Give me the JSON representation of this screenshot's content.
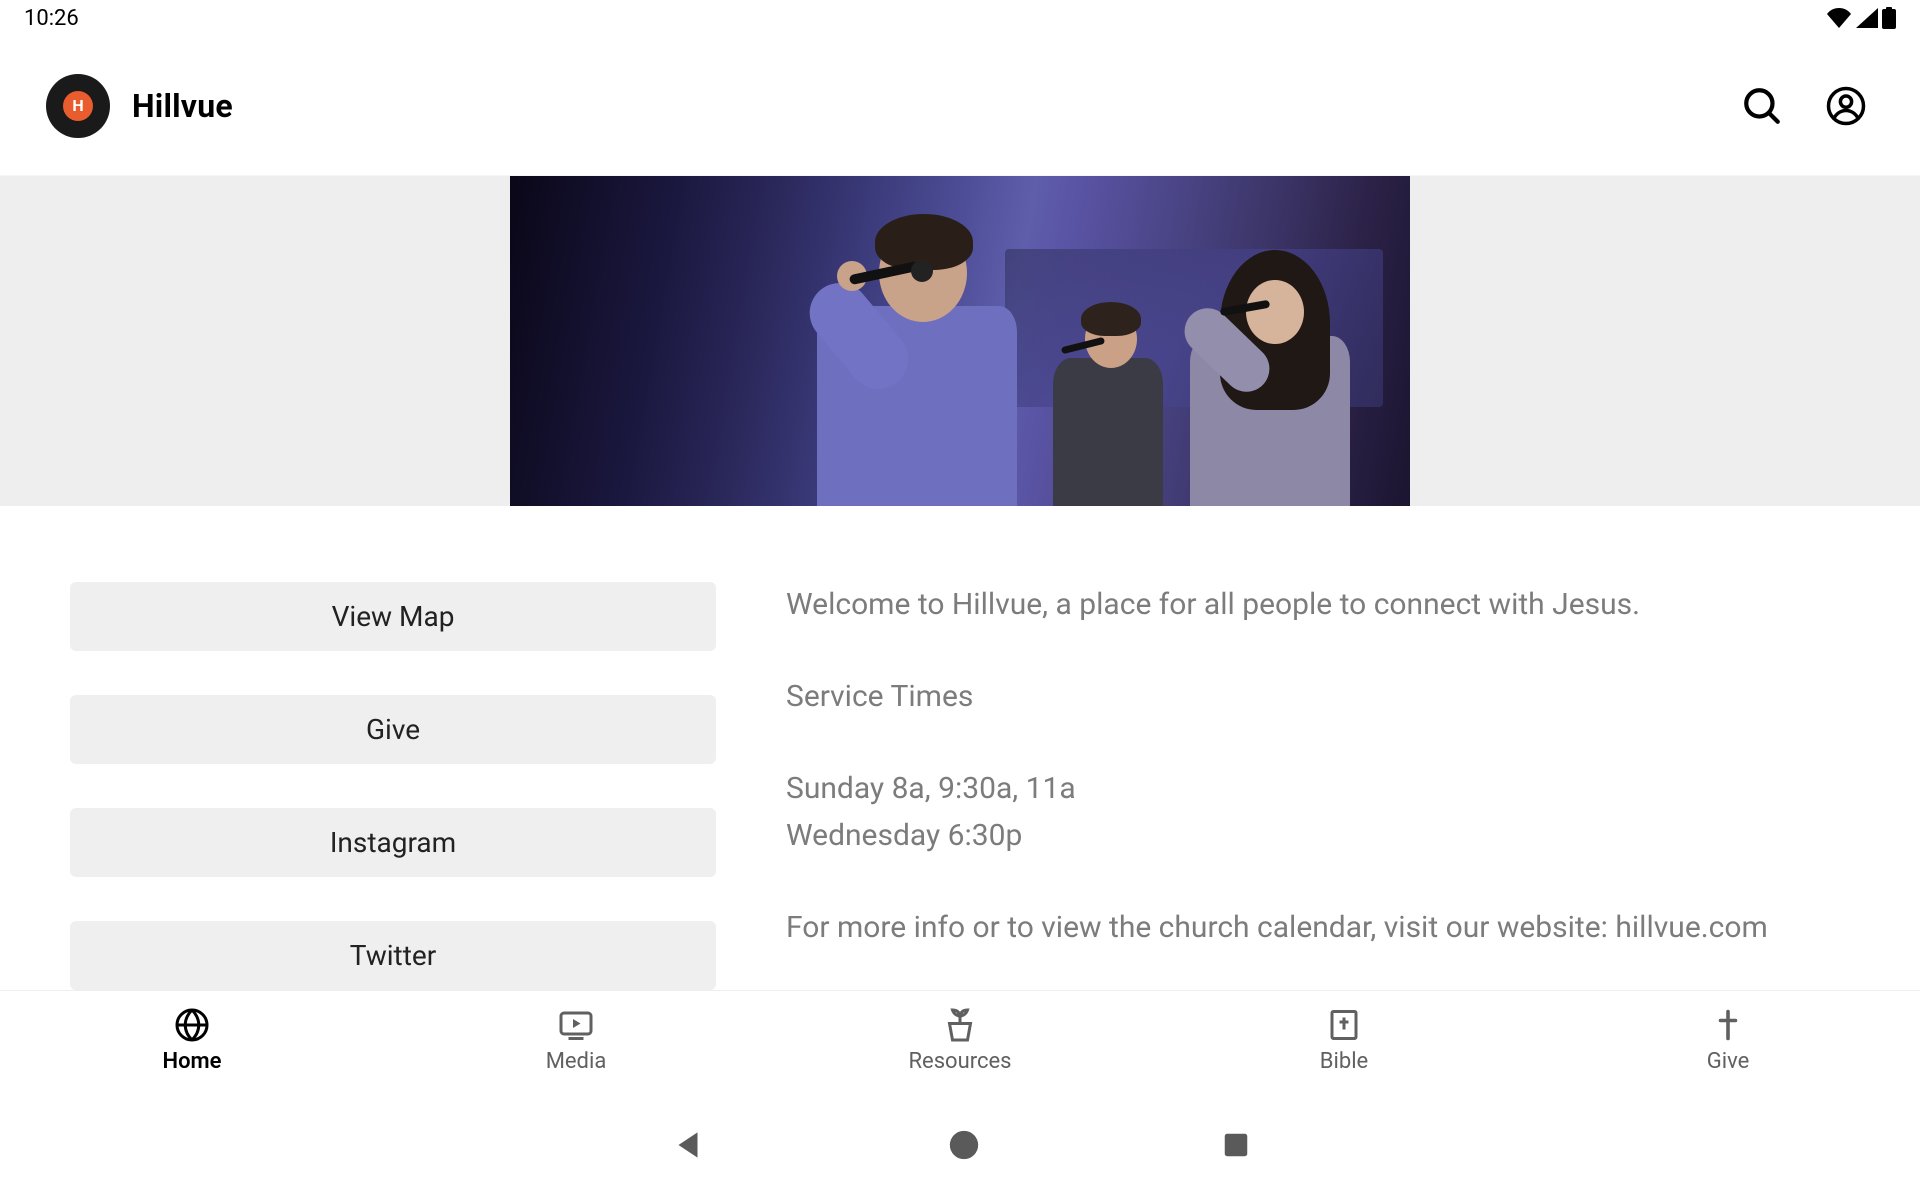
{
  "status": {
    "time": "10:26"
  },
  "header": {
    "title": "Hillvue"
  },
  "actions": [
    {
      "label": "View Map"
    },
    {
      "label": "Give"
    },
    {
      "label": "Instagram"
    },
    {
      "label": "Twitter"
    }
  ],
  "info": {
    "welcome": "Welcome to Hillvue, a place for all people to connect with Jesus.",
    "service_heading": "Service Times",
    "sunday": "Sunday 8a, 9:30a, 11a",
    "wednesday": "Wednesday 6:30p",
    "more": "For more info or to view the church calendar, visit our website: hillvue.com"
  },
  "nav": [
    {
      "label": "Home",
      "active": true
    },
    {
      "label": "Media",
      "active": false
    },
    {
      "label": "Resources",
      "active": false
    },
    {
      "label": "Bible",
      "active": false
    },
    {
      "label": "Give",
      "active": false
    }
  ]
}
